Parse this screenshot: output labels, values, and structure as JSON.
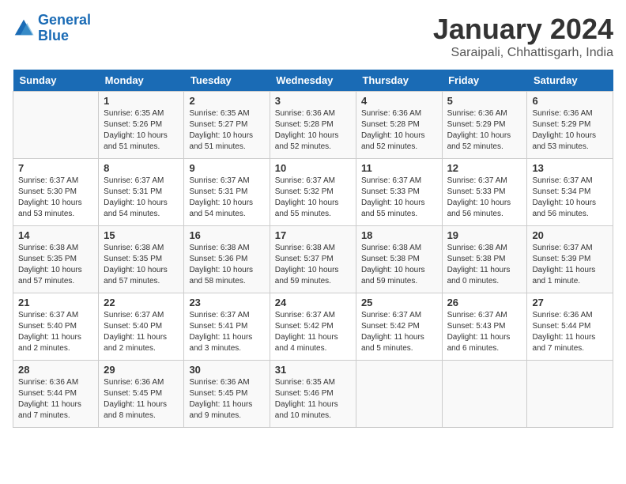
{
  "logo": {
    "line1": "General",
    "line2": "Blue"
  },
  "title": "January 2024",
  "subtitle": "Saraipali, Chhattisgarh, India",
  "days_of_week": [
    "Sunday",
    "Monday",
    "Tuesday",
    "Wednesday",
    "Thursday",
    "Friday",
    "Saturday"
  ],
  "weeks": [
    [
      {
        "day": "",
        "info": ""
      },
      {
        "day": "1",
        "info": "Sunrise: 6:35 AM\nSunset: 5:26 PM\nDaylight: 10 hours\nand 51 minutes."
      },
      {
        "day": "2",
        "info": "Sunrise: 6:35 AM\nSunset: 5:27 PM\nDaylight: 10 hours\nand 51 minutes."
      },
      {
        "day": "3",
        "info": "Sunrise: 6:36 AM\nSunset: 5:28 PM\nDaylight: 10 hours\nand 52 minutes."
      },
      {
        "day": "4",
        "info": "Sunrise: 6:36 AM\nSunset: 5:28 PM\nDaylight: 10 hours\nand 52 minutes."
      },
      {
        "day": "5",
        "info": "Sunrise: 6:36 AM\nSunset: 5:29 PM\nDaylight: 10 hours\nand 52 minutes."
      },
      {
        "day": "6",
        "info": "Sunrise: 6:36 AM\nSunset: 5:29 PM\nDaylight: 10 hours\nand 53 minutes."
      }
    ],
    [
      {
        "day": "7",
        "info": "Sunrise: 6:37 AM\nSunset: 5:30 PM\nDaylight: 10 hours\nand 53 minutes."
      },
      {
        "day": "8",
        "info": "Sunrise: 6:37 AM\nSunset: 5:31 PM\nDaylight: 10 hours\nand 54 minutes."
      },
      {
        "day": "9",
        "info": "Sunrise: 6:37 AM\nSunset: 5:31 PM\nDaylight: 10 hours\nand 54 minutes."
      },
      {
        "day": "10",
        "info": "Sunrise: 6:37 AM\nSunset: 5:32 PM\nDaylight: 10 hours\nand 55 minutes."
      },
      {
        "day": "11",
        "info": "Sunrise: 6:37 AM\nSunset: 5:33 PM\nDaylight: 10 hours\nand 55 minutes."
      },
      {
        "day": "12",
        "info": "Sunrise: 6:37 AM\nSunset: 5:33 PM\nDaylight: 10 hours\nand 56 minutes."
      },
      {
        "day": "13",
        "info": "Sunrise: 6:37 AM\nSunset: 5:34 PM\nDaylight: 10 hours\nand 56 minutes."
      }
    ],
    [
      {
        "day": "14",
        "info": "Sunrise: 6:38 AM\nSunset: 5:35 PM\nDaylight: 10 hours\nand 57 minutes."
      },
      {
        "day": "15",
        "info": "Sunrise: 6:38 AM\nSunset: 5:35 PM\nDaylight: 10 hours\nand 57 minutes."
      },
      {
        "day": "16",
        "info": "Sunrise: 6:38 AM\nSunset: 5:36 PM\nDaylight: 10 hours\nand 58 minutes."
      },
      {
        "day": "17",
        "info": "Sunrise: 6:38 AM\nSunset: 5:37 PM\nDaylight: 10 hours\nand 59 minutes."
      },
      {
        "day": "18",
        "info": "Sunrise: 6:38 AM\nSunset: 5:38 PM\nDaylight: 10 hours\nand 59 minutes."
      },
      {
        "day": "19",
        "info": "Sunrise: 6:38 AM\nSunset: 5:38 PM\nDaylight: 11 hours\nand 0 minutes."
      },
      {
        "day": "20",
        "info": "Sunrise: 6:37 AM\nSunset: 5:39 PM\nDaylight: 11 hours\nand 1 minute."
      }
    ],
    [
      {
        "day": "21",
        "info": "Sunrise: 6:37 AM\nSunset: 5:40 PM\nDaylight: 11 hours\nand 2 minutes."
      },
      {
        "day": "22",
        "info": "Sunrise: 6:37 AM\nSunset: 5:40 PM\nDaylight: 11 hours\nand 2 minutes."
      },
      {
        "day": "23",
        "info": "Sunrise: 6:37 AM\nSunset: 5:41 PM\nDaylight: 11 hours\nand 3 minutes."
      },
      {
        "day": "24",
        "info": "Sunrise: 6:37 AM\nSunset: 5:42 PM\nDaylight: 11 hours\nand 4 minutes."
      },
      {
        "day": "25",
        "info": "Sunrise: 6:37 AM\nSunset: 5:42 PM\nDaylight: 11 hours\nand 5 minutes."
      },
      {
        "day": "26",
        "info": "Sunrise: 6:37 AM\nSunset: 5:43 PM\nDaylight: 11 hours\nand 6 minutes."
      },
      {
        "day": "27",
        "info": "Sunrise: 6:36 AM\nSunset: 5:44 PM\nDaylight: 11 hours\nand 7 minutes."
      }
    ],
    [
      {
        "day": "28",
        "info": "Sunrise: 6:36 AM\nSunset: 5:44 PM\nDaylight: 11 hours\nand 7 minutes."
      },
      {
        "day": "29",
        "info": "Sunrise: 6:36 AM\nSunset: 5:45 PM\nDaylight: 11 hours\nand 8 minutes."
      },
      {
        "day": "30",
        "info": "Sunrise: 6:36 AM\nSunset: 5:45 PM\nDaylight: 11 hours\nand 9 minutes."
      },
      {
        "day": "31",
        "info": "Sunrise: 6:35 AM\nSunset: 5:46 PM\nDaylight: 11 hours\nand 10 minutes."
      },
      {
        "day": "",
        "info": ""
      },
      {
        "day": "",
        "info": ""
      },
      {
        "day": "",
        "info": ""
      }
    ]
  ]
}
